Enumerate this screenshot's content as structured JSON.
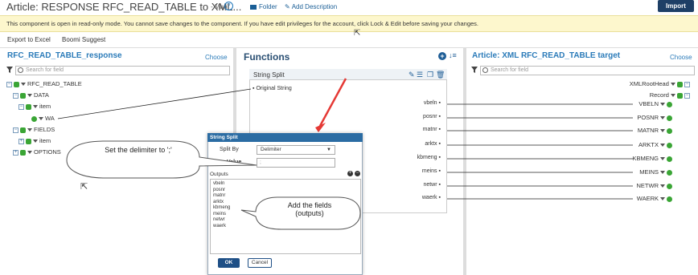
{
  "header": {
    "title": "Article: RESPONSE RFC_READ_TABLE to XML...",
    "map_label": "- Map",
    "folder_label": "Folder",
    "add_description_label": "Add Description",
    "import_label": "Import"
  },
  "banner": {
    "text": "This component is open in read-only mode. You cannot save changes to the component. If you have edit privileges for the account, click Lock & Edit before saving your changes."
  },
  "toolbar": {
    "export_label": "Export to Excel",
    "suggest_label": "Boomi Suggest"
  },
  "source": {
    "title": "RFC_READ_TABLE_response",
    "choose_label": "Choose",
    "search_placeholder": "Search for field",
    "tree": {
      "root": "RFC_READ_TABLE",
      "data": "DATA",
      "data_item": "item",
      "wa": "WA",
      "fields": "FIELDS",
      "fields_item": "item",
      "options": "OPTIONS"
    }
  },
  "functions": {
    "title": "Functions",
    "box_title": "String Split",
    "input_label": "Original String",
    "outputs": [
      "vbeln",
      "posnr",
      "matnr",
      "arktx",
      "kbmeng",
      "meins",
      "netwr",
      "waerk"
    ]
  },
  "target": {
    "title": "Article: XML RFC_READ_TABLE target",
    "choose_label": "Choose",
    "search_placeholder": "Search for field",
    "root": "XMLRootHead",
    "record": "Record",
    "fields": [
      "VBELN",
      "POSNR",
      "MATNR",
      "ARKTX",
      "KBMENG",
      "MEINS",
      "NETWR",
      "WAERK"
    ]
  },
  "dialog": {
    "title": "String Split",
    "split_by_label": "Split By",
    "split_by_value": "Delimiter",
    "value_label": "Value",
    "value_value": ";",
    "outputs_label": "Outputs",
    "outputs": [
      "vbeln",
      "posnr",
      "matnr",
      "arktx",
      "kbmeng",
      "meins",
      "netwr",
      "waerk"
    ],
    "ok_label": "OK",
    "cancel_label": "Cancel"
  },
  "callouts": {
    "delimiter": "Set the delimiter to ';'",
    "fields_line1": "Add the fields",
    "fields_line2": "(outputs)"
  },
  "colors": {
    "accent": "#2b7bb9",
    "banner": "#fdf7cd",
    "import_btn": "#1e3f66",
    "arrow": "#e53935",
    "dialog_head": "#2b6ca3",
    "green": "#3aa535"
  }
}
